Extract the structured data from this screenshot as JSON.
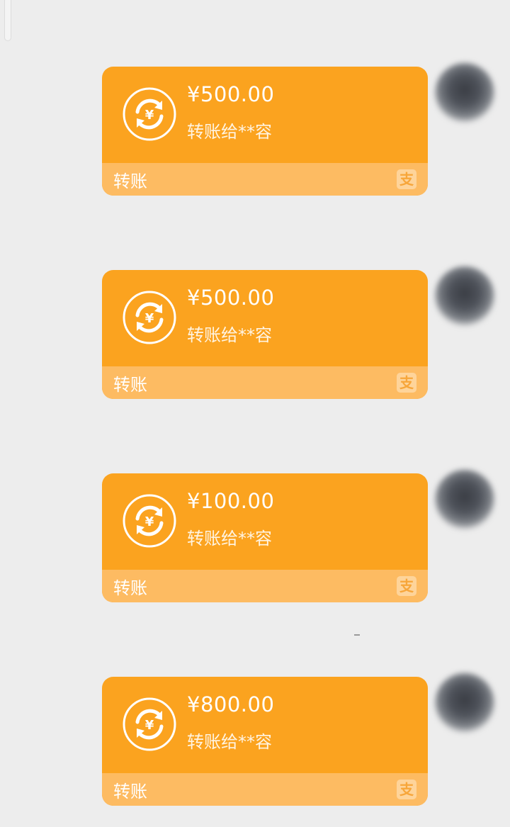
{
  "chat": {
    "messages": [
      {
        "amount": "¥500.00",
        "recipient": "转账给**容",
        "footer_label": "转账",
        "provider_logo_text": "支",
        "icon": "yuan-transfer-icon",
        "avatar": "blurred-avatar"
      },
      {
        "amount": "¥500.00",
        "recipient": "转账给**容",
        "footer_label": "转账",
        "provider_logo_text": "支",
        "icon": "yuan-transfer-icon",
        "avatar": "blurred-avatar"
      },
      {
        "amount": "¥100.00",
        "recipient": "转账给**容",
        "footer_label": "转账",
        "provider_logo_text": "支",
        "icon": "yuan-transfer-icon",
        "avatar": "blurred-avatar"
      },
      {
        "amount": "¥800.00",
        "recipient": "转账给**容",
        "footer_label": "转账",
        "provider_logo_text": "支",
        "icon": "yuan-transfer-icon",
        "avatar": "blurred-avatar"
      }
    ]
  },
  "colors": {
    "background": "#ededed",
    "card_orange": "#fba31f",
    "card_footer": "#fdbb62",
    "text_white": "#ffffff"
  }
}
